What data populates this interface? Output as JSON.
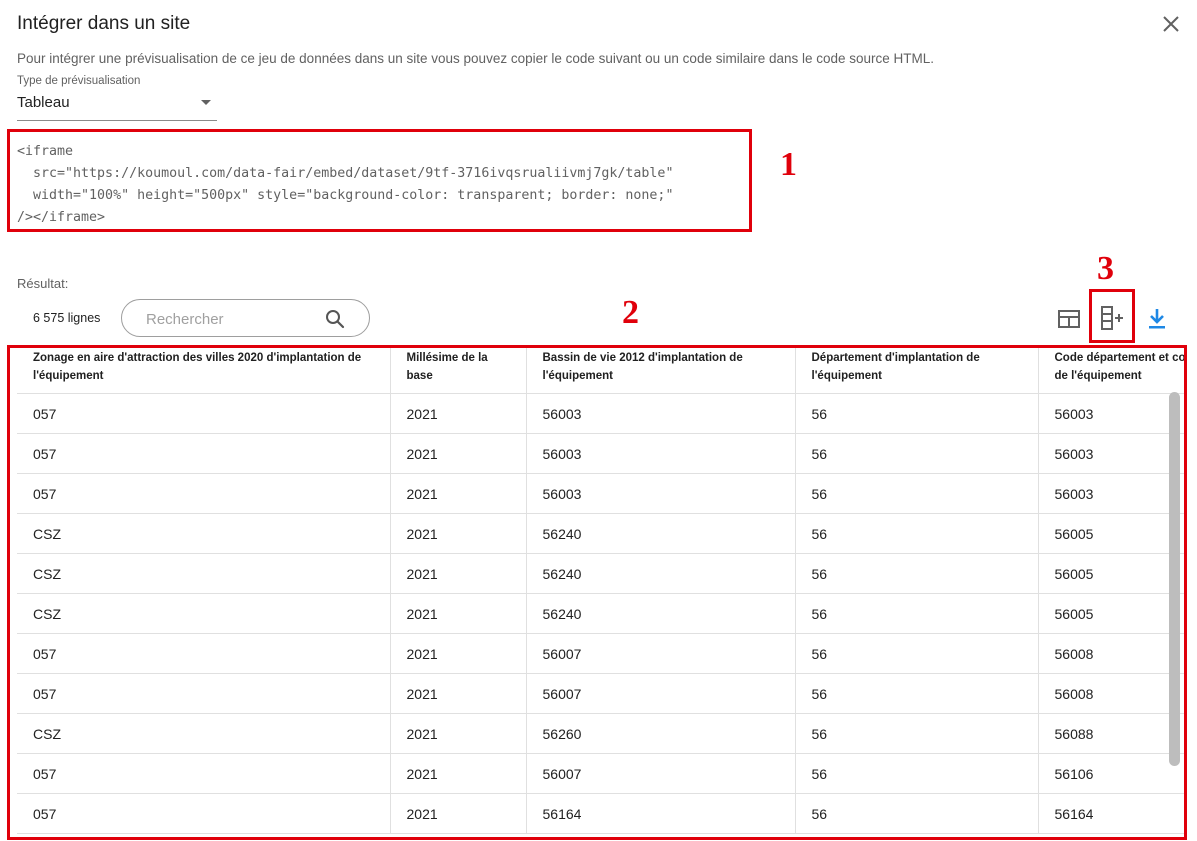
{
  "dialog": {
    "title": "Intégrer dans un site",
    "intro": "Pour intégrer une prévisualisation de ce jeu de données dans un site vous pouvez copier le code suivant ou un code similaire dans le code source HTML."
  },
  "preview_type": {
    "label": "Type de prévisualisation",
    "value": "Tableau"
  },
  "code": {
    "lines": [
      "<iframe",
      "  src=\"https://koumoul.com/data-fair/embed/dataset/9tf-3716ivqsrualiivmj7gk/table\"",
      "  width=\"100%\" height=\"500px\" style=\"background-color: transparent; border: none;\"",
      "/></iframe>"
    ]
  },
  "annotations": {
    "a1": "1",
    "a2": "2",
    "a3": "3"
  },
  "result": {
    "label": "Résultat:",
    "row_count": "6 575 lignes",
    "search_placeholder": "Rechercher"
  },
  "toolbar": {
    "icons": [
      "table-view-icon",
      "add-column-icon",
      "download-icon"
    ],
    "download_color": "#1e88e5"
  },
  "table": {
    "headers": [
      "Zonage en aire d'attraction des villes 2020 d'implantation de l'équipement",
      "Millésime de la base",
      "Bassin de vie 2012 d'implantation de l'équipement",
      "Département d'implantation de l'équipement",
      "Code département et commune de l'équipement"
    ],
    "rows": [
      [
        "057",
        "2021",
        "56003",
        "56",
        "56003"
      ],
      [
        "057",
        "2021",
        "56003",
        "56",
        "56003"
      ],
      [
        "057",
        "2021",
        "56003",
        "56",
        "56003"
      ],
      [
        "CSZ",
        "2021",
        "56240",
        "56",
        "56005"
      ],
      [
        "CSZ",
        "2021",
        "56240",
        "56",
        "56005"
      ],
      [
        "CSZ",
        "2021",
        "56240",
        "56",
        "56005"
      ],
      [
        "057",
        "2021",
        "56007",
        "56",
        "56008"
      ],
      [
        "057",
        "2021",
        "56007",
        "56",
        "56008"
      ],
      [
        "CSZ",
        "2021",
        "56260",
        "56",
        "56088"
      ],
      [
        "057",
        "2021",
        "56007",
        "56",
        "56106"
      ],
      [
        "057",
        "2021",
        "56164",
        "56",
        "56164"
      ],
      [
        "",
        "",
        "",
        "",
        ""
      ]
    ]
  },
  "colors": {
    "annotation": "#e0000b",
    "accent": "#1e88e5"
  }
}
